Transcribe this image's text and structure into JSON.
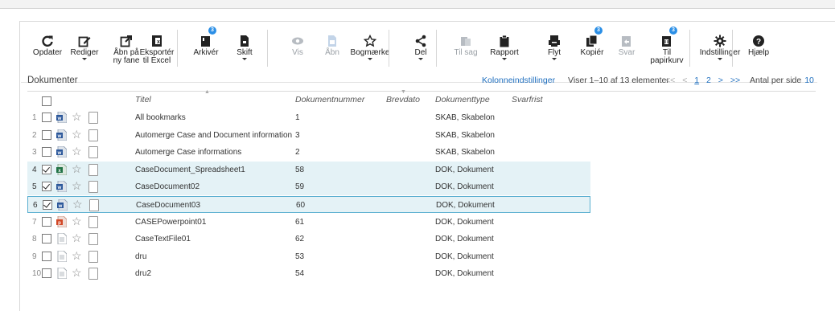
{
  "toolbar": [
    {
      "label": "Opdater",
      "icon": "refresh-icon",
      "dropdown": false,
      "disabled": false,
      "badge": ""
    },
    {
      "label": "Rediger",
      "icon": "edit-icon",
      "dropdown": true,
      "disabled": false,
      "badge": ""
    },
    {
      "label": "Åbn på\nny fane",
      "icon": "open-new-tab-icon",
      "dropdown": false,
      "disabled": false,
      "badge": ""
    },
    {
      "label": "Eksportér\ntil Excel",
      "icon": "excel-export-icon",
      "dropdown": false,
      "disabled": false,
      "badge": ""
    },
    {
      "label": "Arkivér",
      "icon": "archive-icon",
      "dropdown": false,
      "disabled": false,
      "badge": "3"
    },
    {
      "label": "Skift",
      "icon": "switch-doc-icon",
      "dropdown": true,
      "disabled": false,
      "badge": ""
    },
    {
      "label": "Vis",
      "icon": "eye-icon",
      "dropdown": false,
      "disabled": true,
      "badge": ""
    },
    {
      "label": "Åbn",
      "icon": "open-doc-icon",
      "dropdown": false,
      "disabled": true,
      "badge": ""
    },
    {
      "label": "Bogmærke",
      "icon": "star-icon",
      "dropdown": true,
      "disabled": false,
      "badge": ""
    },
    {
      "label": "Del",
      "icon": "share-icon",
      "dropdown": true,
      "disabled": false,
      "badge": ""
    },
    {
      "label": "Til sag",
      "icon": "to-case-icon",
      "dropdown": false,
      "disabled": true,
      "badge": ""
    },
    {
      "label": "Rapport",
      "icon": "clipboard-icon",
      "dropdown": true,
      "disabled": false,
      "badge": ""
    },
    {
      "label": "Flyt",
      "icon": "move-icon",
      "dropdown": true,
      "disabled": false,
      "badge": ""
    },
    {
      "label": "Kopiér",
      "icon": "copy-icon",
      "dropdown": false,
      "disabled": false,
      "badge": "3"
    },
    {
      "label": "Svar",
      "icon": "reply-icon",
      "dropdown": false,
      "disabled": true,
      "badge": ""
    },
    {
      "label": "Til\npapirkurv",
      "icon": "trash-icon",
      "dropdown": false,
      "disabled": false,
      "badge": "3"
    },
    {
      "label": "Indstillinger",
      "icon": "gear-icon",
      "dropdown": true,
      "disabled": false,
      "badge": ""
    },
    {
      "label": "Hjælp",
      "icon": "help-icon",
      "dropdown": false,
      "disabled": false,
      "badge": ""
    }
  ],
  "list": {
    "title": "Dokumenter",
    "column_settings": "Kolonneindstillinger",
    "range_text": "Viser 1–10 af 13 elementer",
    "pages": [
      "1",
      "2"
    ],
    "current_page": "1",
    "per_page_label": "Antal per side",
    "per_page_value": "10"
  },
  "columns": {
    "title": "Titel",
    "docnumber": "Dokumentnummer",
    "letterdate": "Brevdato",
    "doctype": "Dokumenttype",
    "deadline": "Svarfrist"
  },
  "rows": [
    {
      "n": "1",
      "checked": false,
      "file": "word",
      "title": "All bookmarks",
      "number": "1",
      "type": "SKAB, Skabelon"
    },
    {
      "n": "2",
      "checked": false,
      "file": "word",
      "title": "Automerge Case and Document information",
      "number": "3",
      "type": "SKAB, Skabelon"
    },
    {
      "n": "3",
      "checked": false,
      "file": "word",
      "title": "Automerge Case informations",
      "number": "2",
      "type": "SKAB, Skabelon"
    },
    {
      "n": "4",
      "checked": true,
      "file": "excel",
      "title": "CaseDocument_Spreadsheet1",
      "number": "58",
      "type": "DOK, Dokument"
    },
    {
      "n": "5",
      "checked": true,
      "file": "word",
      "title": "CaseDocument02",
      "number": "59",
      "type": "DOK, Dokument"
    },
    {
      "n": "6",
      "checked": true,
      "file": "word",
      "title": "CaseDocument03",
      "number": "60",
      "type": "DOK, Dokument"
    },
    {
      "n": "7",
      "checked": false,
      "file": "powerpoint",
      "title": "CASEPowerpoint01",
      "number": "61",
      "type": "DOK, Dokument"
    },
    {
      "n": "8",
      "checked": false,
      "file": "text",
      "title": "CaseTextFile01",
      "number": "62",
      "type": "DOK, Dokument"
    },
    {
      "n": "9",
      "checked": false,
      "file": "text",
      "title": "dru",
      "number": "53",
      "type": "DOK, Dokument"
    },
    {
      "n": "10",
      "checked": false,
      "file": "text",
      "title": "dru2",
      "number": "54",
      "type": "DOK, Dokument"
    }
  ],
  "colors": {
    "accent": "#1f6fbf",
    "selected_row": "#e4f2f6",
    "badge": "#2b8fe6",
    "word": "#2b579a",
    "excel": "#217346",
    "powerpoint": "#d24726"
  }
}
